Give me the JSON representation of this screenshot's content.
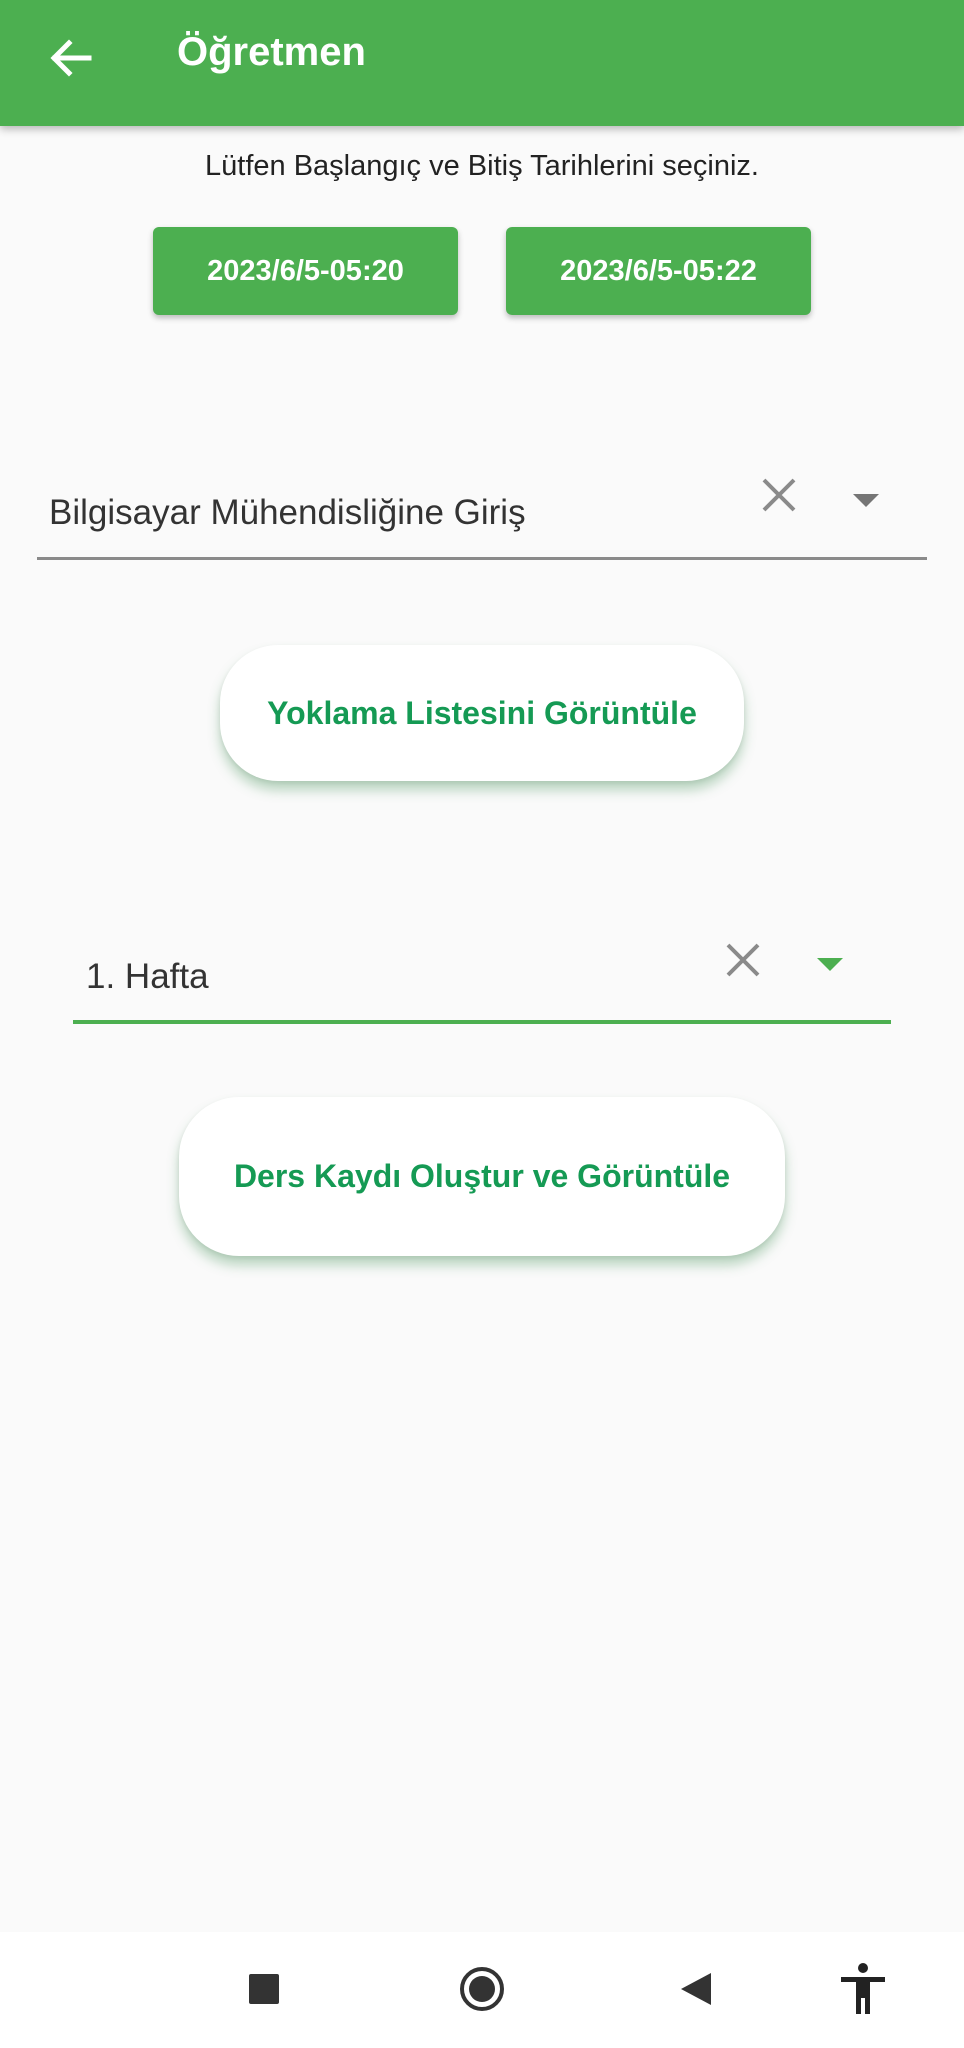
{
  "app_bar": {
    "title": "Öğretmen",
    "background_color": "#4caf50",
    "back_icon": "arrow-left-icon"
  },
  "instruction": "Lütfen Başlangıç ve Bitiş Tarihlerini seçiniz.",
  "dates": {
    "start": "2023/6/5-05:20",
    "end": "2023/6/5-05:22"
  },
  "course_dropdown": {
    "value": "Bilgisayar Mühendisliğine Giriş",
    "clear_icon": "close-icon",
    "expand_icon": "caret-down-icon"
  },
  "attendance_button": {
    "label": "Yoklama Listesini Görüntüle"
  },
  "week_dropdown": {
    "value": "1. Hafta",
    "clear_icon": "close-icon",
    "expand_icon": "caret-down-icon",
    "accent_color": "#4caf50"
  },
  "lesson_button": {
    "label": "Ders Kaydı Oluştur ve Görüntüle"
  },
  "colors": {
    "accent": "#4caf50",
    "button_text": "#159a54",
    "background": "#fafafa"
  },
  "nav_bar": {
    "icons": [
      "recents-square-icon",
      "home-circle-icon",
      "back-triangle-icon",
      "accessibility-icon"
    ]
  }
}
